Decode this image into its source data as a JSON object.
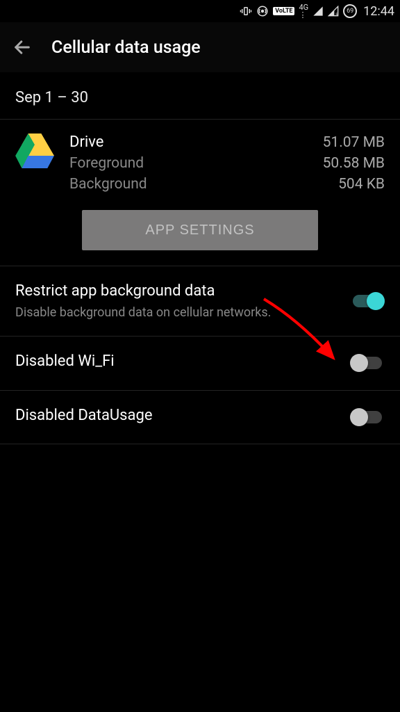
{
  "status_bar": {
    "volte_text": "VoLTE",
    "network_text": "4G",
    "battery_pct": "69",
    "clock": "12:44"
  },
  "header": {
    "title": "Cellular data usage"
  },
  "date_range": "Sep 1 – 30",
  "app": {
    "name": "Drive",
    "total": "51.07 MB",
    "foreground_label": "Foreground",
    "foreground_value": "50.58 MB",
    "background_label": "Background",
    "background_value": "504 KB",
    "settings_btn": "APP SETTINGS"
  },
  "settings": [
    {
      "title": "Restrict app background data",
      "subtitle": "Disable background data on cellular networks.",
      "on": true
    },
    {
      "title": "Disabled Wi_Fi",
      "subtitle": "",
      "on": false
    },
    {
      "title": "Disabled DataUsage",
      "subtitle": "",
      "on": false
    }
  ]
}
